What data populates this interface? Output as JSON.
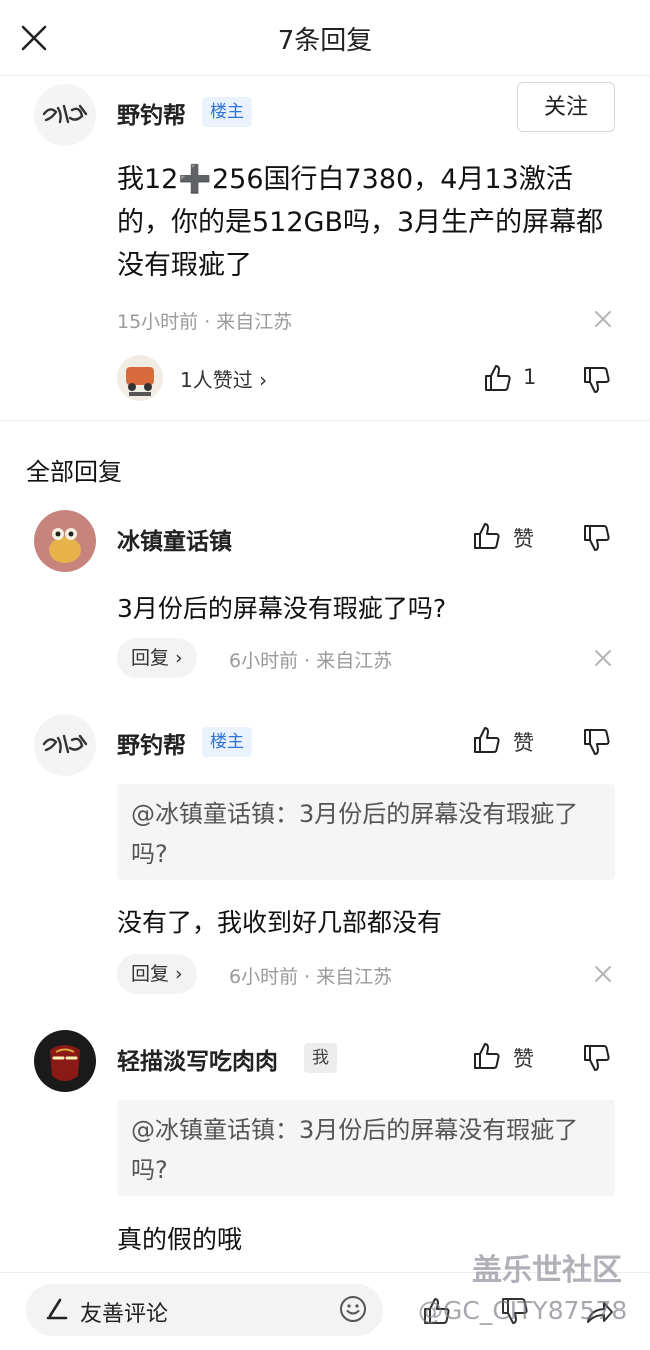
{
  "header": {
    "title": "7条回复"
  },
  "main_post": {
    "author": "野钓帮",
    "badge": "楼主",
    "follow_label": "关注",
    "text": "我12➕256国行白7380，4月13激活的，你的是512GB吗，3月生产的屏幕都没有瑕疵了",
    "meta": "15小时前 · 来自江苏",
    "likers_text": "1人赞过 ›",
    "like_count": "1"
  },
  "section_title": "全部回复",
  "replies": [
    {
      "author": "冰镇童话镇",
      "like_label": "赞",
      "text": "3月份后的屏幕没有瑕疵了吗?",
      "reply_label": "回复 ›",
      "meta": "6小时前 · 来自江苏"
    },
    {
      "author": "野钓帮",
      "badge": "楼主",
      "like_label": "赞",
      "quote": "@冰镇童话镇：3月份后的屏幕没有瑕疵了吗?",
      "text": "没有了，我收到好几部都没有",
      "reply_label": "回复 ›",
      "meta": "6小时前 · 来自江苏"
    },
    {
      "author": "轻描淡写吃肉肉",
      "badge": "我",
      "like_label": "赞",
      "quote": "@冰镇童话镇：3月份后的屏幕没有瑕疵了吗?",
      "text": "真的假的哦"
    }
  ],
  "bottom": {
    "input_placeholder": "友善评论"
  },
  "watermark": {
    "brand": "盖乐世社区",
    "user": "@GC_CITY87578"
  },
  "colors": {
    "badge_blue": "#2f74d8",
    "badge_blue_bg": "#eaf2fd",
    "meta_gray": "#9a9a9a"
  },
  "icons": [
    "close-icon",
    "thumbs-up-icon",
    "thumbs-down-icon",
    "dismiss-icon",
    "pen-icon",
    "emoji-icon",
    "share-icon"
  ]
}
